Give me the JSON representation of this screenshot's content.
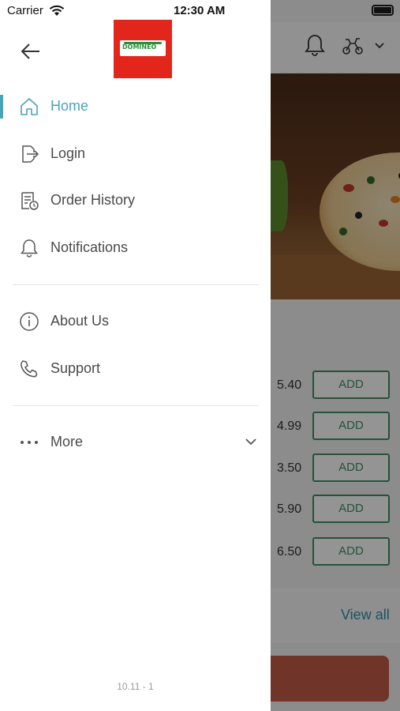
{
  "status_bar": {
    "carrier": "Carrier",
    "time": "12:30 AM"
  },
  "drawer": {
    "logo_text": "DOMINEO",
    "items": [
      {
        "label": "Home",
        "icon": "home-icon",
        "active": true
      },
      {
        "label": "Login",
        "icon": "login-icon"
      },
      {
        "label": "Order History",
        "icon": "order-history-icon"
      },
      {
        "label": "Notifications",
        "icon": "bell-icon"
      },
      {
        "label": "About Us",
        "icon": "info-icon"
      },
      {
        "label": "Support",
        "icon": "phone-icon"
      },
      {
        "label": "More",
        "icon": "more-icon"
      }
    ],
    "version": "10.11 - 1"
  },
  "background": {
    "menu_rows": [
      {
        "price": "5.40",
        "button": "ADD"
      },
      {
        "price": "4.99",
        "button": "ADD"
      },
      {
        "price": "3.50",
        "button": "ADD"
      },
      {
        "price": "5.90",
        "button": "ADD"
      },
      {
        "price": "6.50",
        "button": "ADD"
      }
    ],
    "view_all": "View all"
  },
  "colors": {
    "accent": "#4aa3b7",
    "add_green": "#3f8f63",
    "logo_red": "#e2261c"
  }
}
